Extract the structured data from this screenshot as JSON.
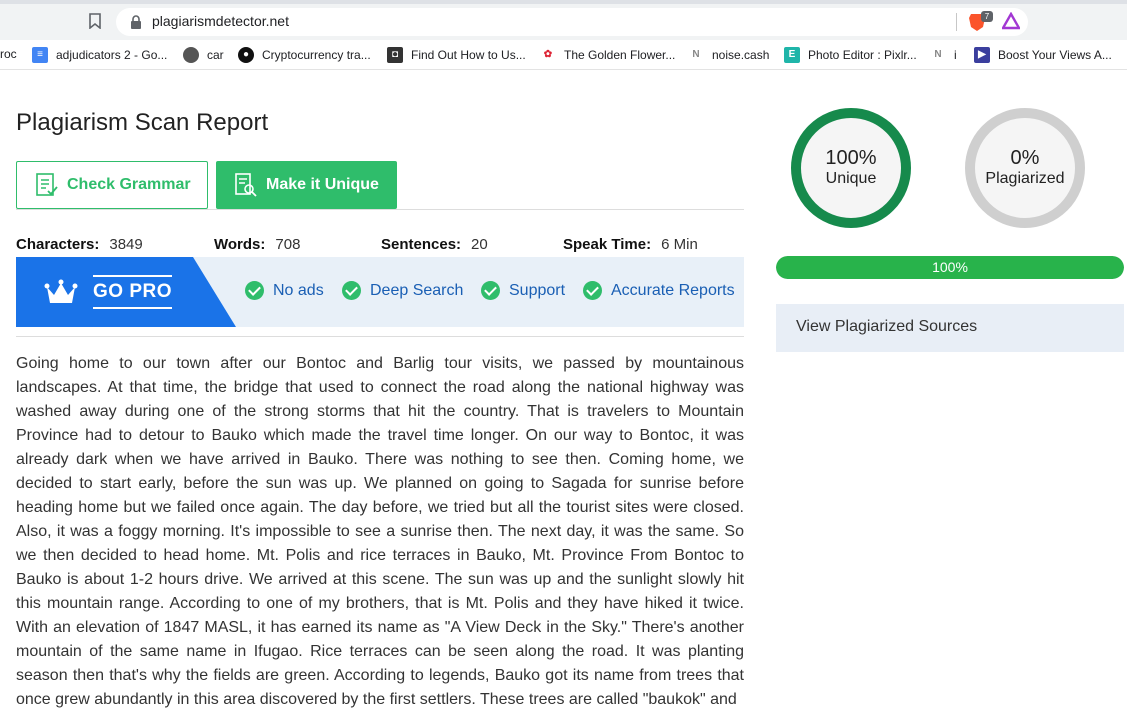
{
  "browser": {
    "url": "plagiarismdetector.net",
    "brave_badge": "7"
  },
  "bookmarks": [
    {
      "label": "roc",
      "icon": "none"
    },
    {
      "label": "adjudicators 2 - Go...",
      "icon": "google-docs-icon"
    },
    {
      "label": "car",
      "icon": "globe-icon"
    },
    {
      "label": "Cryptocurrency tra...",
      "icon": "coinmarket-icon"
    },
    {
      "label": "Find Out How to Us...",
      "icon": "shield-icon"
    },
    {
      "label": "The Golden Flower...",
      "icon": "flower-icon"
    },
    {
      "label": "noise.cash",
      "icon": "noise-icon"
    },
    {
      "label": "Photo Editor : Pixlr...",
      "icon": "pixlr-icon"
    },
    {
      "label": "i",
      "icon": "noise-icon"
    },
    {
      "label": "Boost Your Views A...",
      "icon": "play-icon"
    }
  ],
  "page": {
    "title": "Plagiarism Scan Report",
    "check_grammar": "Check Grammar",
    "make_unique": "Make it Unique"
  },
  "stats": {
    "characters_label": "Characters:",
    "characters": "3849",
    "words_label": "Words:",
    "words": "708",
    "sentences_label": "Sentences:",
    "sentences": "20",
    "speak_label": "Speak Time:",
    "speak": "6 Min"
  },
  "gopro": {
    "label": "GO PRO",
    "features": [
      "No ads",
      "Deep Search",
      "Support",
      "Accurate Reports"
    ]
  },
  "content": "Going home to our town after our Bontoc and Barlig tour visits, we passed by mountainous landscapes. At that time, the bridge that used to connect the road along the national highway was washed away during one of the strong storms that hit the country. That is travelers to Mountain Province had to detour to Bauko which made the travel time longer. On our way to Bontoc, it was already dark when we have arrived in Bauko. There was nothing to see then. Coming home, we decided to start early, before the sun was up. We planned on going to Sagada for sunrise before heading home but we failed once again. The day before, we tried but all the tourist sites were closed. Also, it was a foggy morning. It's impossible to see a sunrise then. The next day, it was the same. So we then decided to head home. Mt. Polis and rice terraces in Bauko, Mt. Province From Bontoc to Bauko is about 1-2 hours drive. We arrived at this scene. The sun was up and the sunlight slowly hit this mountain range. According to one of my brothers, that is Mt. Polis and they have hiked it twice. With an elevation of 1847 MASL, it has earned its name as \"A View Deck in the Sky.\" There's another mountain of the same name in Ifugao. Rice terraces can be seen along the road. It was planting season then that's why the fields are green. According to legends, Bauko got its name from trees that once grew abundantly in this area discovered by the first settlers. These trees are called \"baukok\" and",
  "results": {
    "unique_pct": "100%",
    "unique_label": "Unique",
    "plag_pct": "0%",
    "plag_label": "Plagiarized",
    "progress_text": "100%",
    "progress_value": 1.0,
    "sources_label": "View Plagiarized Sources"
  },
  "colors": {
    "green": "#2fbd6b",
    "dark_green": "#168a4c",
    "blue": "#1a73e8"
  }
}
